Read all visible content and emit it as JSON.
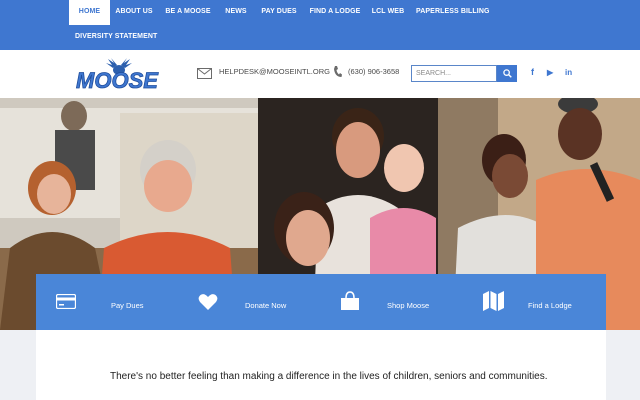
{
  "nav": {
    "items": [
      {
        "label": "HOME",
        "active": true
      },
      {
        "label": "ABOUT US"
      },
      {
        "label": "BE A MOOSE"
      },
      {
        "label": "NEWS"
      },
      {
        "label": "PAY DUES"
      },
      {
        "label": "FIND A LODGE"
      },
      {
        "label": "LCL WEB"
      },
      {
        "label": "PAPERLESS BILLING"
      },
      {
        "label": "DIVERSITY STATEMENT"
      }
    ]
  },
  "header": {
    "logo_text": "MOOSE",
    "email": "HELPDESK@MOOSEINTL.ORG",
    "phone": "(630) 906-3658",
    "search": {
      "placeholder": "SEARCH...",
      "value": ""
    },
    "social": [
      {
        "icon": "facebook-icon",
        "glyph": "f"
      },
      {
        "icon": "youtube-icon",
        "glyph": "▶"
      },
      {
        "icon": "linkedin-icon",
        "glyph": "in"
      }
    ]
  },
  "actions": [
    {
      "label": "Pay Dues",
      "icon": "credit-card-icon"
    },
    {
      "label": "Donate Now",
      "icon": "heart-icon"
    },
    {
      "label": "Shop Moose",
      "icon": "shopping-bag-icon"
    },
    {
      "label": "Find a Lodge",
      "icon": "map-icon"
    }
  ],
  "content": {
    "tagline": "There's no better feeling than making a difference in the lives of children, seniors and communities."
  },
  "colors": {
    "brand_blue": "#3f77d0",
    "action_blue": "#4a86d8"
  }
}
